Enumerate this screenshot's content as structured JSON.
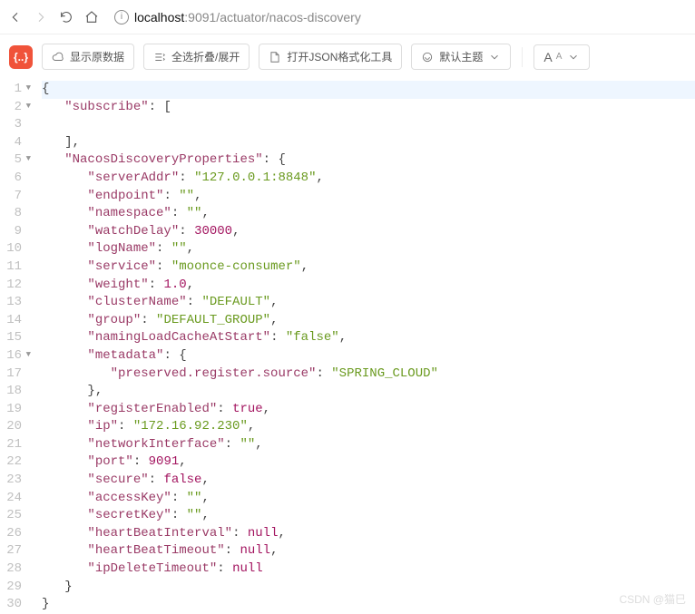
{
  "nav": {
    "url_prefix": "localhost",
    "url_rest": ":9091/actuator/nacos-discovery"
  },
  "toolbar": {
    "logo": "{..}",
    "raw": "显示原数据",
    "foldexpand": "全选折叠/展开",
    "openfmt": "打开JSON格式化工具",
    "theme": "默认主题",
    "font": "A"
  },
  "json": {
    "subscribe_key": "subscribe",
    "ndp_key": "NacosDiscoveryProperties",
    "ndp": {
      "serverAddr": "127.0.0.1:8848",
      "endpoint": "",
      "namespace": "",
      "watchDelay": 30000,
      "logName": "",
      "service": "moonce-consumer",
      "weight": 1.0,
      "clusterName": "DEFAULT",
      "group": "DEFAULT_GROUP",
      "namingLoadCacheAtStart": "false",
      "metadata_key": "metadata",
      "metadata": {
        "preserved.register.source": "SPRING_CLOUD"
      },
      "registerEnabled": true,
      "ip": "172.16.92.230",
      "networkInterface": "",
      "port": 9091,
      "secure": false,
      "accessKey": "",
      "secretKey": "",
      "heartBeatInterval": null,
      "heartBeatTimeout": null,
      "ipDeleteTimeout": null
    }
  },
  "watermark": "CSDN @猫巳"
}
